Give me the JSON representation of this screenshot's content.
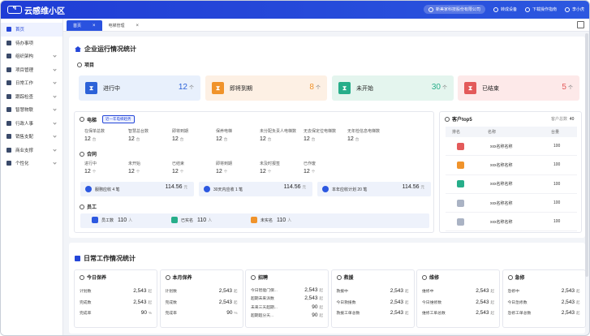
{
  "app": {
    "logo_text": "云感维小区",
    "logo_mark": "ꟼ"
  },
  "topbar": {
    "company": "新美家科技股份有限公司",
    "items": [
      "转成设备",
      "下载操作指南",
      "李小虎"
    ]
  },
  "sidebar": {
    "items": [
      {
        "label": "首页",
        "active": true,
        "chev": false
      },
      {
        "label": "待办事项",
        "chev": false
      },
      {
        "label": "组织架构",
        "chev": true
      },
      {
        "label": "项目管理",
        "chev": true
      },
      {
        "label": "日常工作",
        "chev": true
      },
      {
        "label": "跟踪检查",
        "chev": true
      },
      {
        "label": "智慧物联",
        "chev": true
      },
      {
        "label": "行政人事",
        "chev": true
      },
      {
        "label": "销售支配",
        "chev": true
      },
      {
        "label": "商业支撑",
        "chev": true
      },
      {
        "label": "个性化",
        "chev": true
      }
    ]
  },
  "tabs": [
    {
      "label": "首页",
      "active": true
    },
    {
      "label": "电梯管理"
    }
  ],
  "overview": {
    "title": "企业运行情况统计",
    "project_title": "项目",
    "stats": [
      {
        "label": "进行中",
        "value": "12",
        "unit": "个",
        "color": "#2c62d8",
        "bg": "#e8f0fc",
        "vcolor": "#2c62d8"
      },
      {
        "label": "即将到期",
        "value": "8",
        "unit": "个",
        "color": "#f0932b",
        "bg": "#fdf0e4",
        "vcolor": "#f0932b"
      },
      {
        "label": "未开始",
        "value": "30",
        "unit": "个",
        "color": "#27ae8a",
        "bg": "#e4f5ee",
        "vcolor": "#27ae8a"
      },
      {
        "label": "已结束",
        "value": "5",
        "unit": "个",
        "color": "#e35a5a",
        "bg": "#fde9e9",
        "vcolor": "#e35a5a"
      }
    ]
  },
  "elevator": {
    "title": "电梯",
    "badge": "近一年电梯趋势",
    "cells": [
      {
        "k": "在保单总数",
        "v": "12",
        "u": "台"
      },
      {
        "k": "智慧总台数",
        "v": "12",
        "u": "台"
      },
      {
        "k": "即将到期",
        "v": "12",
        "u": "台"
      },
      {
        "k": "保养电梯",
        "v": "12",
        "u": "台"
      },
      {
        "k": "未分配负责人电梯数",
        "v": "12",
        "u": "台"
      },
      {
        "k": "无去保定位电梯数",
        "v": "12",
        "u": "台"
      },
      {
        "k": "无年检信息电梯数",
        "v": "12",
        "u": "台"
      }
    ]
  },
  "contract": {
    "title": "合同",
    "cells": [
      {
        "k": "进行中",
        "v": "12",
        "u": "个"
      },
      {
        "k": "未开始",
        "v": "12",
        "u": "个"
      },
      {
        "k": "已结束",
        "v": "12",
        "u": "个"
      },
      {
        "k": "即将到期",
        "v": "12",
        "u": "个"
      },
      {
        "k": "未及时报签",
        "v": "12",
        "u": "个"
      },
      {
        "k": "已作废",
        "v": "12",
        "u": "个"
      }
    ],
    "strips": [
      {
        "label": "服務应收 4 笔",
        "v": "114.56",
        "u": "元"
      },
      {
        "label": "30天内应收 1 笔",
        "v": "114.56",
        "u": "元"
      },
      {
        "label": "本年应收计划 20 笔",
        "v": "114.56",
        "u": "元"
      }
    ]
  },
  "staff": {
    "title": "员工",
    "items": [
      {
        "label": "员工数",
        "v": "110",
        "u": "人"
      },
      {
        "label": "已实名",
        "v": "110",
        "u": "人"
      },
      {
        "label": "未实名",
        "v": "110",
        "u": "人"
      }
    ]
  },
  "top5": {
    "title": "客户top5",
    "sub_label": "客户总数",
    "sub_value": "40",
    "headers": [
      "排名",
      "名称",
      "台量"
    ],
    "rows": [
      {
        "name": "xxx名称名称",
        "v": "100",
        "c": "#e35a5a"
      },
      {
        "name": "xxx名称名称",
        "v": "100",
        "c": "#f0932b"
      },
      {
        "name": "xxx名称名称",
        "v": "100",
        "c": "#27ae8a"
      },
      {
        "name": "xxx名称名称",
        "v": "100",
        "c": "#aab3c4"
      },
      {
        "name": "xxx名称名称",
        "v": "100",
        "c": "#aab3c4"
      }
    ]
  },
  "daily": {
    "title": "日常工作情况统计",
    "cards": [
      {
        "title": "今日保养",
        "rows": [
          {
            "k": "计划数",
            "v": "2,543",
            "u": "起"
          },
          {
            "k": "完成数",
            "v": "2,543",
            "u": "起"
          },
          {
            "k": "完成率",
            "v": "90",
            "u": "%"
          }
        ]
      },
      {
        "title": "本月保养",
        "rows": [
          {
            "k": "计划数",
            "v": "2,543",
            "u": "起"
          },
          {
            "k": "完成数",
            "v": "2,543",
            "u": "起"
          },
          {
            "k": "完成率",
            "v": "90",
            "u": "%"
          }
        ]
      },
      {
        "title": "招聘",
        "rows": [
          {
            "k": "今日智能门保...",
            "v": "2,543",
            "u": "起"
          },
          {
            "k": "超期未来派数",
            "v": "2,543",
            "u": "起"
          },
          {
            "k": "未来三天超期...",
            "v": "90",
            "u": "起"
          },
          {
            "k": "超期超分天...",
            "v": "90",
            "u": "起"
          }
        ]
      },
      {
        "title": "救援",
        "rows": [
          {
            "k": "救援中",
            "v": "2,543",
            "u": "起"
          },
          {
            "k": "今日救援数",
            "v": "2,543",
            "u": "起"
          },
          {
            "k": "救援工单总数",
            "v": "2,543",
            "u": "起"
          }
        ]
      },
      {
        "title": "维修",
        "rows": [
          {
            "k": "维修中",
            "v": "2,543",
            "u": "起"
          },
          {
            "k": "今日维修数",
            "v": "2,543",
            "u": "起"
          },
          {
            "k": "维修工单总数",
            "v": "2,543",
            "u": "起"
          }
        ]
      },
      {
        "title": "急修",
        "rows": [
          {
            "k": "急修中",
            "v": "2,543",
            "u": "起"
          },
          {
            "k": "今日急修数",
            "v": "2,543",
            "u": "起"
          },
          {
            "k": "急修工单总数",
            "v": "2,543",
            "u": "起"
          }
        ]
      }
    ]
  }
}
